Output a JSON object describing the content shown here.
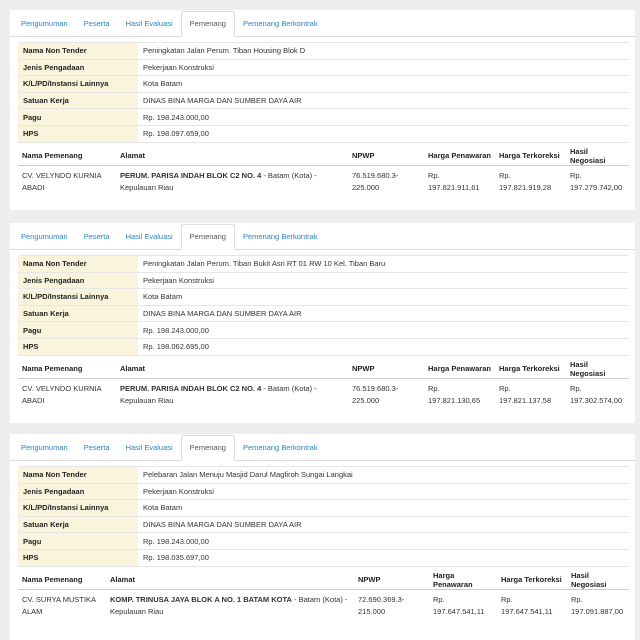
{
  "tabs": [
    "Pengumuman",
    "Peserta",
    "Hasil Evaluasi",
    "Pemenang",
    "Pemenang Berkontrak"
  ],
  "labels": {
    "nama_non_tender": "Nama Non Tender",
    "jenis_pengadaan": "Jenis Pengadaan",
    "klpd": "K/L/PD/Instansi Lainnya",
    "satuan_kerja": "Satuan Kerja",
    "pagu": "Pagu",
    "hps": "HPS"
  },
  "columns": [
    "Nama Pemenang",
    "Alamat",
    "NPWP",
    "Harga Penawaran",
    "Harga Terkoreksi",
    "Hasil Negosiasi"
  ],
  "panels": [
    {
      "nama_non_tender": "Peningkatan Jalan Perum. Tiban Housing Blok D",
      "jenis_pengadaan": "Pekerjaan Konstruksi",
      "klpd": "Kota Batam",
      "satuan_kerja": "DINAS BINA MARGA DAN SUMBER DAYA AIR",
      "pagu": "Rp. 198.243.000,00",
      "hps": "Rp. 198.097.659,00",
      "winner": {
        "nama": "CV. VELYNDO KURNIA ABADI",
        "alamat_bold": "PERUM. PARISA INDAH BLOK C2 NO. 4",
        "alamat_rest": " - Batam (Kota) - Kepulauan Riau",
        "npwp": "76.519.680.3-225.000",
        "harga_penawaran": "Rp. 197.821.911,61",
        "harga_terkoreksi": "Rp. 197.821.919,28",
        "hasil_negosiasi": "Rp. 197.279.742,00"
      }
    },
    {
      "nama_non_tender": "Peningkatan Jalan Perum. Tiban Bukit Asri RT 01 RW 10 Kel. Tiban Baru",
      "jenis_pengadaan": "Pekerjaan Konstruksi",
      "klpd": "Kota Batam",
      "satuan_kerja": "DINAS BINA MARGA DAN SUMBER DAYA AIR",
      "pagu": "Rp. 198.243.000,00",
      "hps": "Rp. 198.062.695,00",
      "winner": {
        "nama": "CV. VELYNDO KURNIA ABADI",
        "alamat_bold": "PERUM. PARISA INDAH BLOK C2 NO. 4",
        "alamat_rest": " - Batam (Kota) - Kepulauan Riau",
        "npwp": "76.519.680.3-225.000",
        "harga_penawaran": "Rp. 197.821.130,65",
        "harga_terkoreksi": "Rp. 197.821.137,58",
        "hasil_negosiasi": "Rp. 197.302.574,00"
      }
    },
    {
      "nama_non_tender": "Pelebaran Jalan Menuju Masjid Darul Magfiroh Sungai Langkai",
      "jenis_pengadaan": "Pekerjaan Konstruksi",
      "klpd": "Kota Batam",
      "satuan_kerja": "DINAS BINA MARGA DAN SUMBER DAYA AIR",
      "pagu": "Rp. 198.243.000,00",
      "hps": "Rp. 198.035.697,00",
      "winner": {
        "nama": "CV. SURYA MUSTIKA ALAM",
        "alamat_bold": "KOMP. TRINUSA JAYA BLOK A NO. 1 BATAM KOTA",
        "alamat_rest": " - Batam (Kota) - Kepulauan Riau",
        "npwp": "72.690.369.3-215.000",
        "harga_penawaran": "Rp. 197.647.541,11",
        "harga_terkoreksi": "Rp. 197.647.541,11",
        "hasil_negosiasi": "Rp. 197.091.887,00"
      }
    }
  ]
}
